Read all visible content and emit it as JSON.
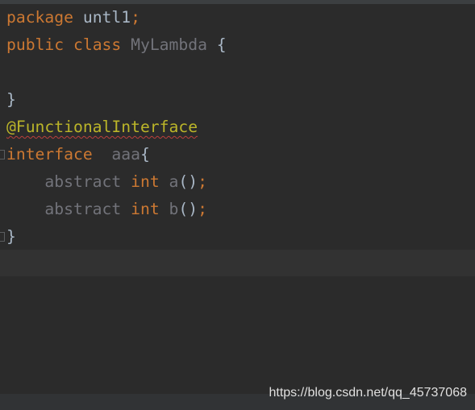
{
  "colors": {
    "background": "#2b2b2b",
    "keyword": "#cc7832",
    "identifier": "#a9b7c6",
    "unused": "#72737a",
    "annotation": "#bbb529",
    "current_line": "#323232"
  },
  "code": {
    "l1": {
      "kw": "package",
      "name": "untl1",
      "semi": ";"
    },
    "l2": {
      "kw1": "public",
      "kw2": "class",
      "name": "MyLambda",
      "brace": "{"
    },
    "l4": {
      "brace": "}"
    },
    "l5": {
      "annotation": "@FunctionalInterface"
    },
    "l6": {
      "kw": "interface",
      "name": "aaa",
      "brace": "{"
    },
    "l7": {
      "mod": "abstract",
      "type": "int",
      "name": "a",
      "parens": "()",
      "semi": ";"
    },
    "l8": {
      "mod": "abstract",
      "type": "int",
      "name": "b",
      "parens": "()",
      "semi": ";"
    },
    "l9": {
      "brace": "}"
    }
  },
  "watermark": "https://blog.csdn.net/qq_45737068"
}
